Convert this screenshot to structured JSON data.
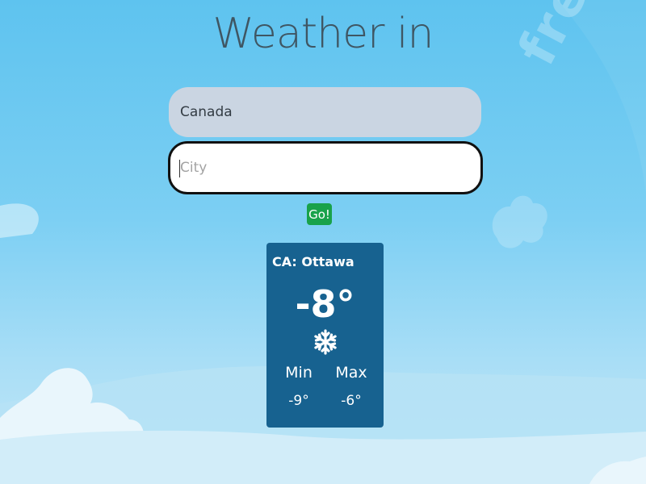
{
  "page": {
    "title": "Weather in",
    "watermark": "freepik"
  },
  "form": {
    "country_value": "Canada",
    "city_value": "",
    "city_placeholder": "City",
    "go_label": "Go!"
  },
  "weather": {
    "location": "CA: Ottawa",
    "temperature": "-8°",
    "condition_icon": "snowflake-icon",
    "min_label": "Min",
    "max_label": "Max",
    "min_value": "-9°",
    "max_value": "-6°"
  },
  "colors": {
    "sky_top": "#5ec3ef",
    "sky_bottom": "#c4e8f8",
    "card_bg": "#176290",
    "go_button": "#19a24a",
    "country_field_bg": "#cad5e2",
    "title_text": "#3f5663"
  }
}
